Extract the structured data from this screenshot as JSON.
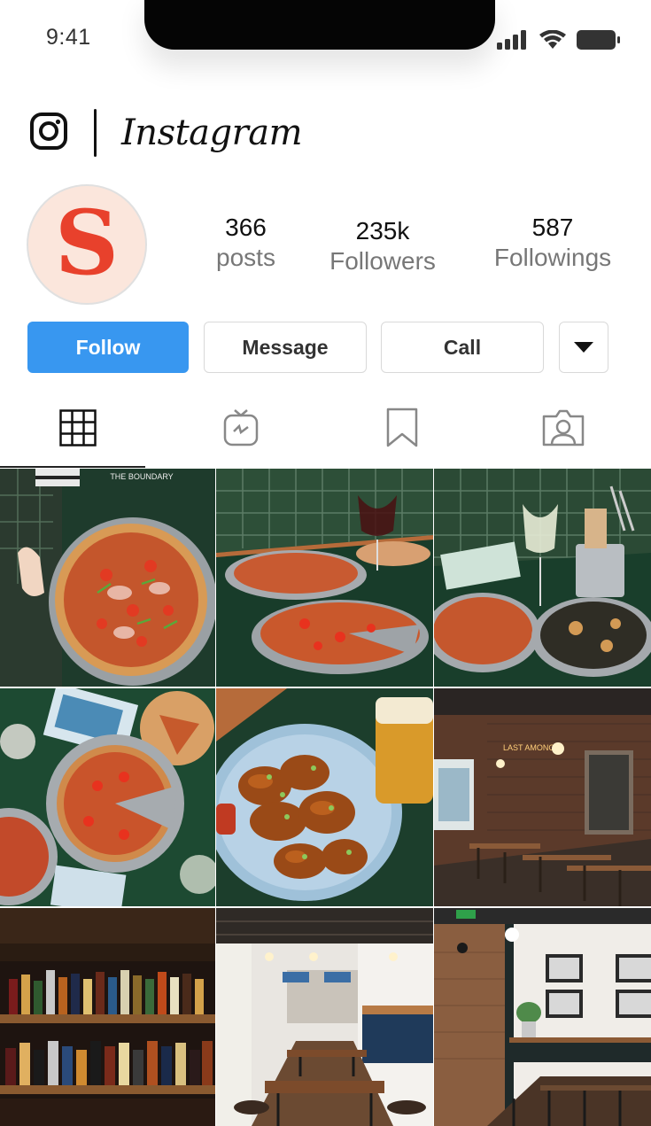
{
  "status_bar": {
    "time": "9:41",
    "icons": [
      "signal-icon",
      "wifi-icon",
      "battery-icon"
    ]
  },
  "header": {
    "logo_icon": "instagram-logo-icon",
    "brand": "Instagram"
  },
  "profile": {
    "avatar_letter": "S",
    "avatar_color": "#e8412c",
    "avatar_bg": "#fbe6dc",
    "stats": {
      "posts_count": "366",
      "posts_label": "posts",
      "followers_count": "235k",
      "followers_label": "Followers",
      "followings_count": "587",
      "followings_label": "Followings"
    }
  },
  "actions": {
    "follow_label": "Follow",
    "message_label": "Message",
    "call_label": "Call",
    "more_icon": "caret-down-icon"
  },
  "tabs": [
    {
      "icon": "grid-icon",
      "active": true
    },
    {
      "icon": "igtv-icon",
      "active": false
    },
    {
      "icon": "bookmark-icon",
      "active": false
    },
    {
      "icon": "tagged-person-icon",
      "active": false
    }
  ],
  "posts": [
    {
      "subject": "pizza-held-over-table",
      "overlay_text": "THE BOUNDARY"
    },
    {
      "subject": "two-pizzas-with-red-wine"
    },
    {
      "subject": "pizzas-with-white-wine-and-cutlery"
    },
    {
      "subject": "overhead-pizzas-on-green-table"
    },
    {
      "subject": "glazed-chicken-wings-with-beer"
    },
    {
      "subject": "brick-dining-room-neon-sign"
    },
    {
      "subject": "bar-shelves-with-bottles"
    },
    {
      "subject": "pub-interior-long-tables"
    },
    {
      "subject": "bright-dining-room-framed-pictures"
    }
  ],
  "colors": {
    "accent": "#3897f0",
    "border": "#d9d9d9",
    "tile_green": "#1f4a33"
  }
}
